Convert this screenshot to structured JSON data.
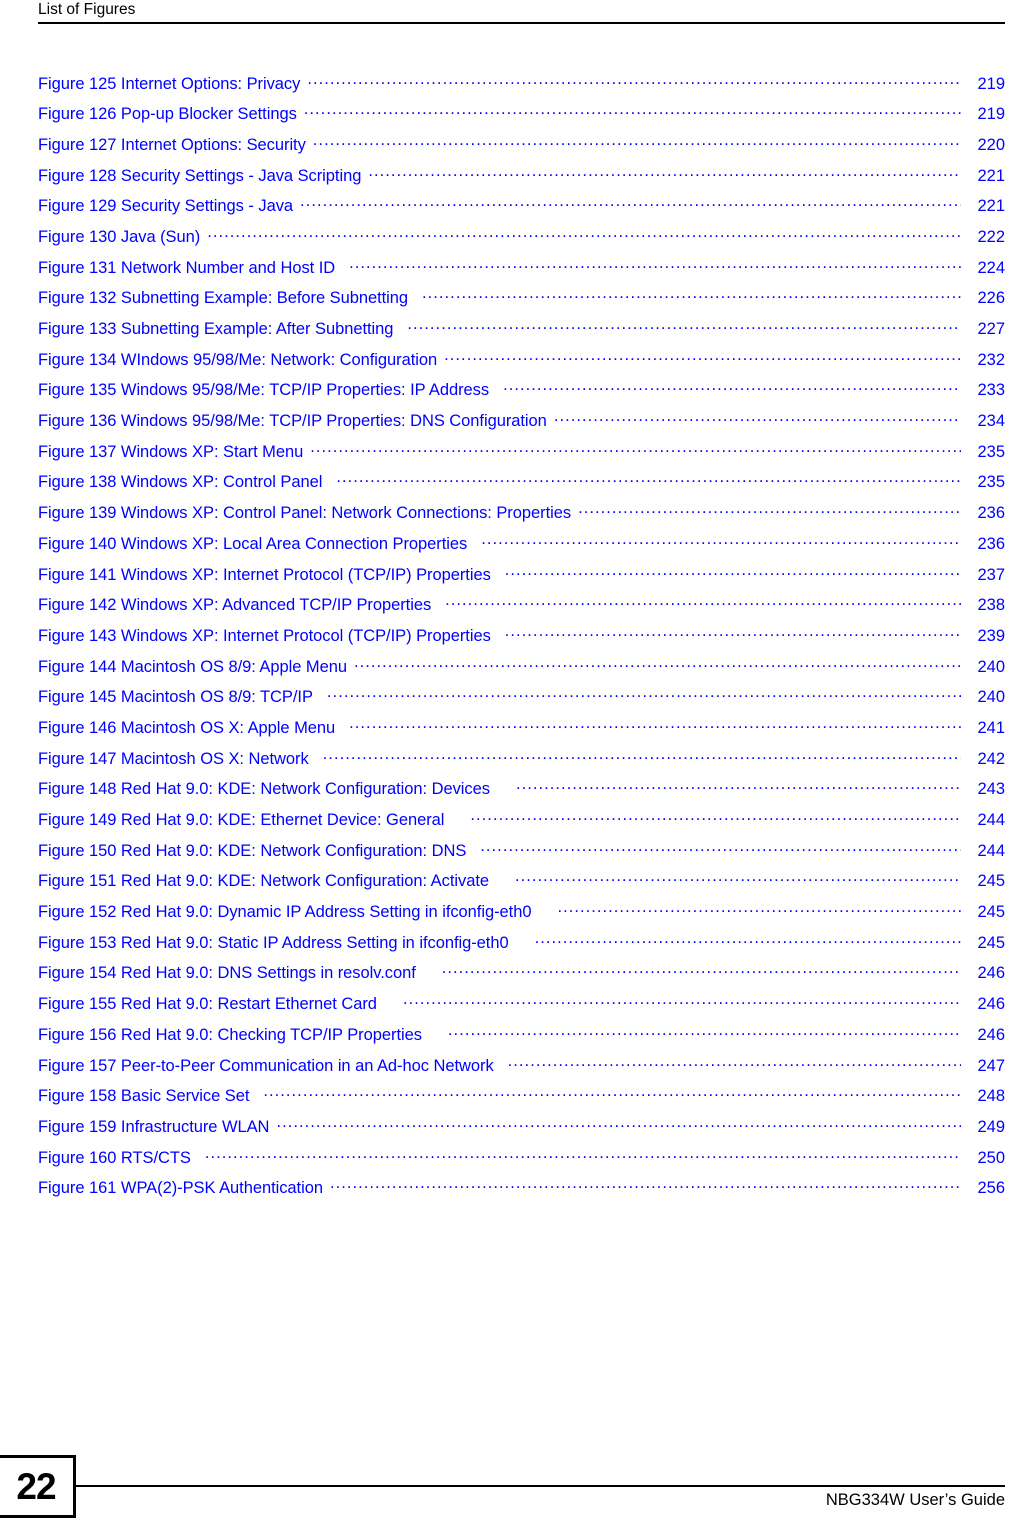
{
  "header": {
    "title": "List of Figures"
  },
  "figure_list": [
    {
      "label": "Figure 125 Internet Options: Privacy",
      "page": "219",
      "gap": "s"
    },
    {
      "label": "Figure 126 Pop-up Blocker Settings",
      "page": "219",
      "gap": "s"
    },
    {
      "label": "Figure 127 Internet Options: Security",
      "page": "220",
      "gap": "s"
    },
    {
      "label": "Figure 128 Security Settings - Java Scripting",
      "page": "221",
      "gap": "s"
    },
    {
      "label": "Figure 129 Security Settings - Java",
      "page": "221",
      "gap": "s"
    },
    {
      "label": "Figure 130 Java (Sun)",
      "page": "222",
      "gap": "s"
    },
    {
      "label": "Figure 131 Network Number and Host ID",
      "page": "224",
      "gap": "m"
    },
    {
      "label": "Figure 132 Subnetting Example: Before Subnetting",
      "page": "226",
      "gap": "m"
    },
    {
      "label": "Figure 133 Subnetting Example: After Subnetting",
      "page": "227",
      "gap": "m"
    },
    {
      "label": "Figure 134 WIndows 95/98/Me: Network: Configuration",
      "page": "232",
      "gap": "s"
    },
    {
      "label": "Figure 135 Windows 95/98/Me: TCP/IP Properties: IP Address",
      "page": "233",
      "gap": "m"
    },
    {
      "label": "Figure 136 Windows 95/98/Me: TCP/IP Properties: DNS Configuration",
      "page": "234",
      "gap": "s"
    },
    {
      "label": "Figure 137 Windows XP: Start Menu",
      "page": "235",
      "gap": "s"
    },
    {
      "label": "Figure 138 Windows XP: Control Panel",
      "page": "235",
      "gap": "m"
    },
    {
      "label": "Figure 139 Windows XP: Control Panel: Network Connections: Properties",
      "page": "236",
      "gap": "s"
    },
    {
      "label": "Figure 140 Windows XP: Local Area Connection Properties",
      "page": "236",
      "gap": "m"
    },
    {
      "label": "Figure 141 Windows XP: Internet Protocol (TCP/IP) Properties",
      "page": "237",
      "gap": "m"
    },
    {
      "label": "Figure 142 Windows XP: Advanced TCP/IP Properties",
      "page": "238",
      "gap": "m"
    },
    {
      "label": "Figure 143 Windows XP: Internet Protocol (TCP/IP) Properties",
      "page": "239",
      "gap": "m"
    },
    {
      "label": "Figure 144 Macintosh OS 8/9: Apple Menu",
      "page": "240",
      "gap": "s"
    },
    {
      "label": "Figure 145 Macintosh OS 8/9: TCP/IP",
      "page": "240",
      "gap": "m"
    },
    {
      "label": "Figure 146 Macintosh OS X: Apple Menu",
      "page": "241",
      "gap": "m"
    },
    {
      "label": "Figure 147 Macintosh OS X: Network",
      "page": "242",
      "gap": "m"
    },
    {
      "label": "Figure 148 Red Hat 9.0: KDE: Network Configuration: Devices",
      "page": "243",
      "gap": "l"
    },
    {
      "label": "Figure 149 Red Hat 9.0: KDE: Ethernet Device: General",
      "page": "244",
      "gap": "l"
    },
    {
      "label": "Figure 150 Red Hat 9.0: KDE: Network Configuration: DNS",
      "page": "244",
      "gap": "m"
    },
    {
      "label": "Figure 151 Red Hat 9.0: KDE: Network Configuration: Activate",
      "page": "245",
      "gap": "l"
    },
    {
      "label": "Figure 152 Red Hat 9.0: Dynamic IP Address Setting in ifconfig-eth0",
      "page": "245",
      "gap": "l"
    },
    {
      "label": "Figure 153 Red Hat 9.0: Static IP Address Setting in ifconfig-eth0",
      "page": "245",
      "gap": "l"
    },
    {
      "label": "Figure 154 Red Hat 9.0: DNS Settings in resolv.conf",
      "page": "246",
      "gap": "l"
    },
    {
      "label": "Figure 155 Red Hat 9.0: Restart Ethernet Card",
      "page": "246",
      "gap": "l"
    },
    {
      "label": "Figure 156 Red Hat 9.0: Checking TCP/IP Properties",
      "page": "246",
      "gap": "l"
    },
    {
      "label": "Figure 157 Peer-to-Peer Communication in an Ad-hoc Network",
      "page": "247",
      "gap": "m"
    },
    {
      "label": "Figure 158 Basic Service Set",
      "page": "248",
      "gap": "m"
    },
    {
      "label": "Figure 159 Infrastructure WLAN",
      "page": "249",
      "gap": "s"
    },
    {
      "label": "Figure 160  RTS/CTS",
      "page": "250",
      "gap": "m"
    },
    {
      "label": "Figure 161 WPA(2)-PSK Authentication",
      "page": "256",
      "gap": "s"
    }
  ],
  "footer": {
    "page_number": "22",
    "guide": "NBG334W User’s Guide"
  },
  "colors": {
    "entry_blue": "#0000ff",
    "text_black": "#000000",
    "background": "#ffffff"
  }
}
